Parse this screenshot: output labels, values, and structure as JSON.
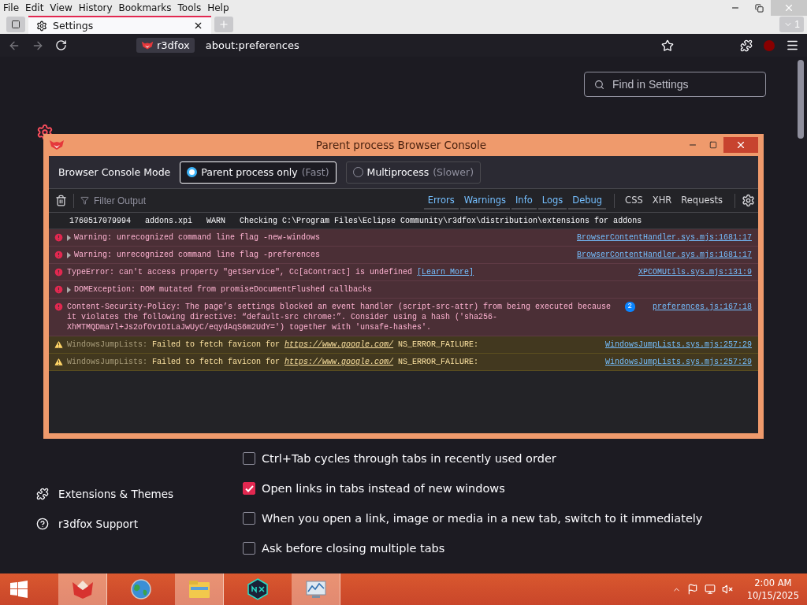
{
  "menu_bar": [
    "File",
    "Edit",
    "View",
    "History",
    "Bookmarks",
    "Tools",
    "Help"
  ],
  "tabs": [
    {
      "label": "Settings",
      "selected": true
    }
  ],
  "tab_count": "1",
  "identity": "r3dfox",
  "url": "about:preferences",
  "settings": {
    "search": {
      "placeholder": "Find in Settings"
    },
    "sidebar_footer": [
      "Extensions & Themes",
      "r3dfox Support"
    ],
    "options": [
      {
        "label": "Ctrl+Tab cycles through tabs in recently used order",
        "checked": false
      },
      {
        "label": "Open links in tabs instead of new windows",
        "checked": true
      },
      {
        "label": "When you open a link, image or media in a new tab, switch to it immediately",
        "checked": false
      },
      {
        "label": "Ask before closing multiple tabs",
        "checked": false
      }
    ]
  },
  "console": {
    "title": "Parent process Browser Console",
    "mode_label": "Browser Console Mode",
    "modes": [
      {
        "label": "Parent process only",
        "hint": "(Fast)",
        "selected": true
      },
      {
        "label": "Multiprocess",
        "hint": "(Slower)",
        "selected": false
      }
    ],
    "filter": {
      "placeholder": "Filter Output"
    },
    "levels": [
      {
        "label": "Errors",
        "selected": true
      },
      {
        "label": "Warnings",
        "selected": true
      },
      {
        "label": "Info",
        "selected": true
      },
      {
        "label": "Logs",
        "selected": true
      },
      {
        "label": "Debug",
        "selected": true
      }
    ],
    "types": [
      {
        "label": "CSS",
        "selected": false
      },
      {
        "label": "XHR",
        "selected": false
      },
      {
        "label": "Requests",
        "selected": false
      }
    ],
    "messages": [
      {
        "kind": "log",
        "columns": [
          "1760517079994",
          "addons.xpi",
          "WARN",
          "Checking C:\\Program Files\\Eclipse Community\\r3dfox\\distribution\\extensions for addons"
        ]
      },
      {
        "kind": "error",
        "expandable": true,
        "parts": [
          {
            "kind": "text",
            "text": "Warning: unrecognized command line flag -new-windows"
          }
        ],
        "source": "BrowserContentHandler.sys.mjs:1681:17"
      },
      {
        "kind": "error",
        "expandable": true,
        "parts": [
          {
            "kind": "text",
            "text": "Warning: unrecognized command line flag -preferences"
          }
        ],
        "source": "BrowserContentHandler.sys.mjs:1681:17"
      },
      {
        "kind": "error",
        "expandable": false,
        "parts": [
          {
            "kind": "text",
            "text": "TypeError: can't access property \"getService\", Cc[aContract] is undefined"
          },
          {
            "kind": "link",
            "text": "[Learn More]"
          }
        ],
        "source": "XPCOMUtils.sys.mjs:131:9"
      },
      {
        "kind": "error",
        "expandable": true,
        "parts": [
          {
            "kind": "text",
            "text": "DOMException: DOM mutated from promiseDocumentFlushed callbacks"
          }
        ]
      },
      {
        "kind": "error",
        "expandable": false,
        "parts": [
          {
            "kind": "text",
            "text": "Content-Security-Policy: The page’s settings blocked an event handler (script-src-attr) from being executed because it violates the following directive: “default-src chrome:”. Consider using a hash ('sha256-XhMTMQDma7l+Js2ofOv1OILaJwUyC/eqydAqS6m2UdY=') together with 'unsafe-hashes'."
          }
        ],
        "count": "2",
        "source": "preferences.js:167:18"
      },
      {
        "kind": "warning",
        "expandable": false,
        "parts": [
          {
            "kind": "muted",
            "text": "WindowsJumpLists:"
          },
          {
            "kind": "text",
            "text": "Failed to fetch favicon for"
          },
          {
            "kind": "url",
            "text": "https://www.google.com/"
          },
          {
            "kind": "text",
            "text": "NS_ERROR_FAILURE:"
          }
        ],
        "source": "WindowsJumpLists.sys.mjs:257:29"
      },
      {
        "kind": "warning",
        "expandable": false,
        "parts": [
          {
            "kind": "muted",
            "text": "WindowsJumpLists:"
          },
          {
            "kind": "text",
            "text": "Failed to fetch favicon for"
          },
          {
            "kind": "url",
            "text": "https://www.google.com/"
          },
          {
            "kind": "text",
            "text": "NS_ERROR_FAILURE:"
          }
        ],
        "source": "WindowsJumpLists.sys.mjs:257:29"
      }
    ]
  },
  "taskbar": {
    "apps": [
      {
        "kind": "fox",
        "selected": true
      },
      {
        "kind": "globe",
        "selected": false
      },
      {
        "kind": "folder",
        "selected": true
      },
      {
        "kind": "nox",
        "selected": false
      },
      {
        "kind": "monitor",
        "selected": true
      }
    ],
    "time": "2:00 AM",
    "date": "10/15/2025"
  }
}
